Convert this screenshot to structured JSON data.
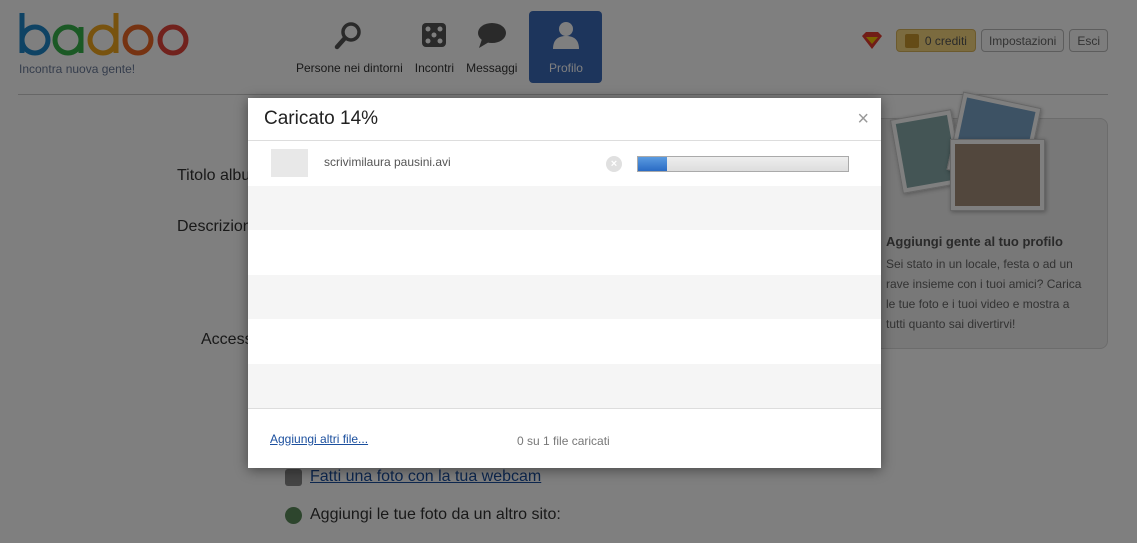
{
  "header": {
    "tagline": "Incontra nuova gente!",
    "nav": [
      {
        "label": "Persone nei dintorni",
        "icon": "search-icon"
      },
      {
        "label": "Incontri",
        "icon": "dice-icon"
      },
      {
        "label": "Messaggi",
        "icon": "chat-bubble-icon"
      },
      {
        "label": "Profilo",
        "icon": "user-icon",
        "active": true
      }
    ],
    "credits_label": "0 crediti",
    "settings_label": "Impostazioni",
    "logout_label": "Esci"
  },
  "form": {
    "album_title_label": "Titolo album",
    "description_label": "Descrizione",
    "access_label": "Accesso"
  },
  "promo": {
    "title": "Aggiungi gente al tuo profilo",
    "text": "Sei stato in un locale, festa o ad un rave insieme con i tuoi amici? Carica le tue foto e i tuoi video e mostra a tutti quanto sai divertirvi!"
  },
  "page_links": {
    "webcam": "Fatti una foto con la tua webcam",
    "other_site": "Aggiungi le tue foto da un altro sito:"
  },
  "modal": {
    "title": "Caricato 14%",
    "close_glyph": "×",
    "file": {
      "name": "scrivimilaura pausini.avi",
      "progress": 0.14
    },
    "add_more_label": "Aggiungi altri file...",
    "count_label": "0 su 1 file caricati"
  },
  "colors": {
    "accent": "#3b6ab8",
    "progress": "#2a6bc4",
    "credits": "#f6d67e"
  }
}
